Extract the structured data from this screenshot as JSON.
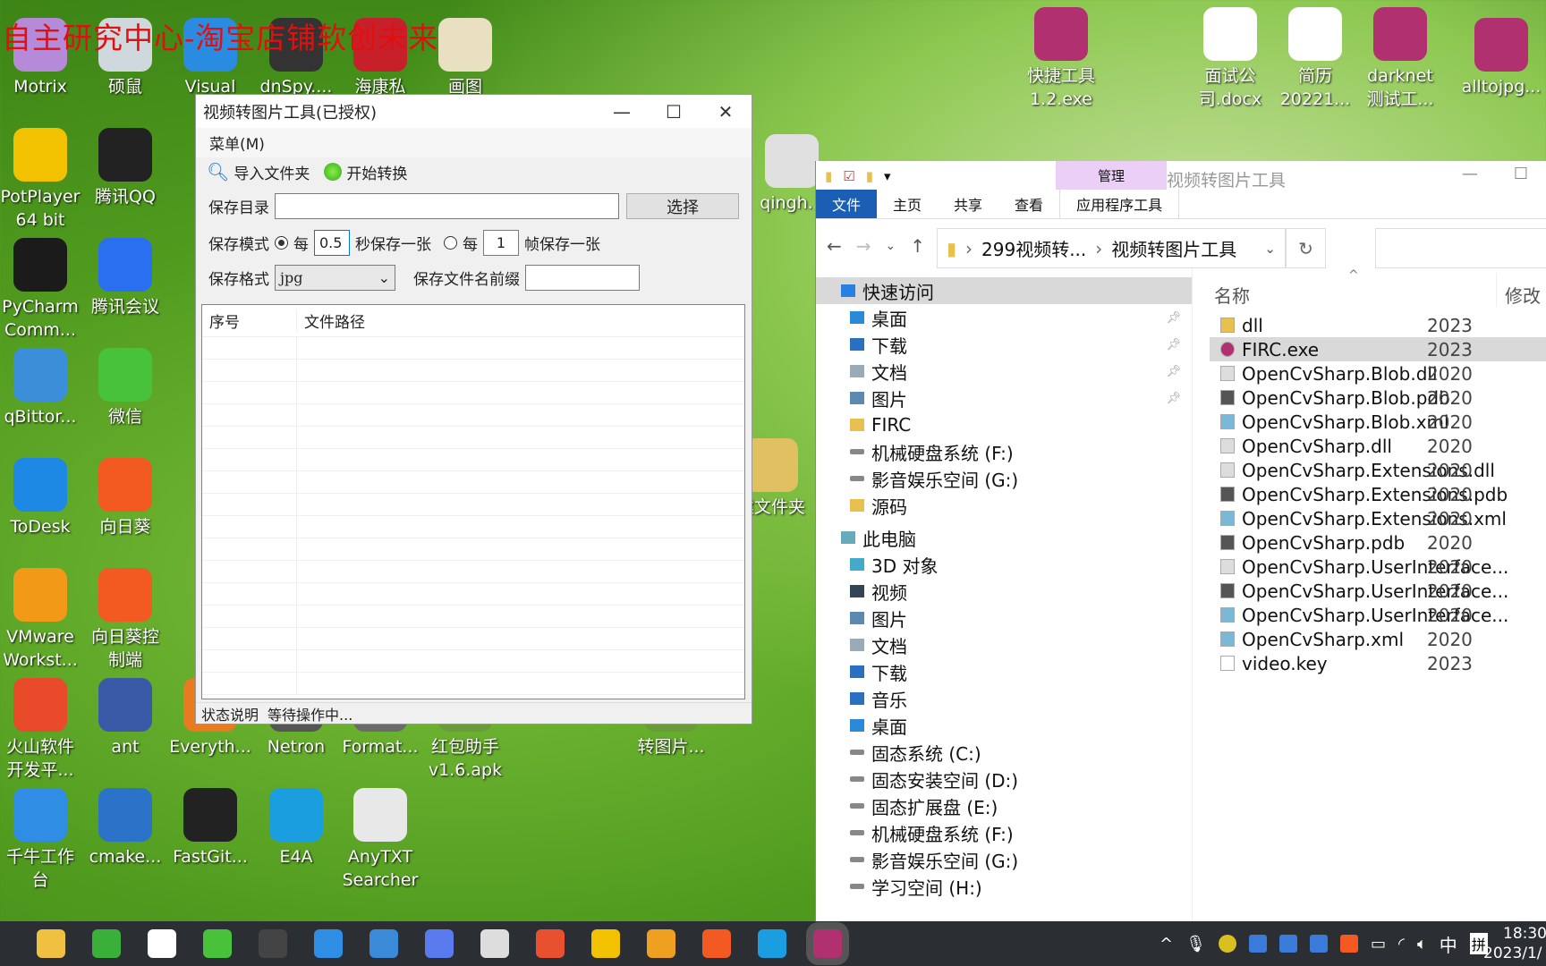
{
  "watermark": "自主研究中心-淘宝店铺软创未来",
  "desktop_icons": [
    {
      "label": "Motrix",
      "color": "#b58ad8"
    },
    {
      "label": "PotPlayer 64 bit",
      "color": "#f2c200"
    },
    {
      "label": "PyCharm Comm...",
      "color": "#1b1b1b"
    },
    {
      "label": "qBittor...",
      "color": "#3b8fd9"
    },
    {
      "label": "ToDesk",
      "color": "#1e88e5"
    },
    {
      "label": "VMware Workst...",
      "color": "#f29a18"
    },
    {
      "label": "火山软件开发平...",
      "color": "#e84a2a"
    },
    {
      "label": "千牛工作台",
      "color": "#2f8de4"
    },
    {
      "label": "硕鼠",
      "color": "#cfd8dc"
    },
    {
      "label": "腾讯QQ",
      "color": "#222222"
    },
    {
      "label": "腾讯会议",
      "color": "#2a6ff0"
    },
    {
      "label": "微信",
      "color": "#48c23a"
    },
    {
      "label": "向日葵",
      "color": "#f25a22"
    },
    {
      "label": "向日葵控制端",
      "color": "#f25a22"
    },
    {
      "label": "ant",
      "color": "#3a5aa8"
    },
    {
      "label": "cmake...",
      "color": "#2a73c8"
    },
    {
      "label": "Visual S...",
      "color": "#2a8ce0"
    },
    {
      "label": "Everyth...",
      "color": "#e87a20"
    },
    {
      "label": "FastGit...",
      "color": "#222222"
    },
    {
      "label": "dnSpy....",
      "color": "#333333"
    },
    {
      "label": "Netron",
      "color": "#555555"
    },
    {
      "label": "E4A",
      "color": "#1a9ee0"
    },
    {
      "label": "海康私有...",
      "color": "#c8202a"
    },
    {
      "label": "Format...",
      "color": "#6a6a6a"
    },
    {
      "label": "AnyTXT Searcher",
      "color": "#e8e8e8"
    },
    {
      "label": "画图",
      "color": "#e8e0c0"
    },
    {
      "label": "红包助手 v1.6.apk",
      "color": "#6a9a3a"
    },
    {
      "label": "qingh...",
      "color": "#e0e0e0"
    },
    {
      "label": "建文件夹",
      "color": "#e0c060"
    },
    {
      "label": "转图片...",
      "color": "#6a9a3a"
    },
    {
      "label": "快捷工具 1.2.exe",
      "color": "#b03070"
    },
    {
      "label": "面试公司.docx",
      "color": "#ffffff"
    },
    {
      "label": "简历 20221...",
      "color": "#ffffff"
    },
    {
      "label": "darknet 测试工...",
      "color": "#b03070"
    },
    {
      "label": "alltojpg...",
      "color": "#b03070"
    }
  ],
  "app": {
    "title": "视频转图片工具(已授权)",
    "menu": "菜单(M)",
    "toolbar": {
      "import": "导入文件夹",
      "start": "开始转换"
    },
    "save_dir_label": "保存目录",
    "save_dir_value": "",
    "choose_btn": "选择",
    "mode_label": "保存模式",
    "per": "每",
    "seconds_value": "0.5",
    "seconds_suffix": "秒保存一张",
    "per2": "每",
    "frames_value": "1",
    "frames_suffix": "帧保存一张",
    "mode_selected": "seconds",
    "format_label": "保存格式",
    "format_value": "jpg",
    "prefix_label": "保存文件名前缀",
    "prefix_value": "",
    "columns": [
      "序号",
      "文件路径"
    ],
    "status_label": "状态说明",
    "status_text": "等待操作中..."
  },
  "explorer": {
    "title": "视频转图片工具",
    "context_tab": "管理",
    "context_sub": "应用程序工具",
    "tabs": [
      "文件",
      "主页",
      "共享",
      "查看"
    ],
    "breadcrumb": [
      "299视频转...",
      "视频转图片工具"
    ],
    "nav": [
      "快速访问",
      "桌面",
      "下载",
      "文档",
      "图片",
      "FIRC",
      "机械硬盘系统 (F:)",
      "影音娱乐空间 (G:)",
      "源码",
      "此电脑",
      "3D 对象",
      "视频",
      "图片",
      "文档",
      "下载",
      "音乐",
      "桌面",
      "固态系统 (C:)",
      "固态安装空间 (D:)",
      "固态扩展盘 (E:)",
      "机械硬盘系统 (F:)",
      "影音娱乐空间 (G:)",
      "学习空间 (H:)"
    ],
    "col_name": "名称",
    "col_date": "修改",
    "files": [
      {
        "name": "dll",
        "date": "2023",
        "type": "folder"
      },
      {
        "name": "FIRC.exe",
        "date": "2023",
        "type": "exe",
        "selected": true
      },
      {
        "name": "OpenCvSharp.Blob.dll",
        "date": "2020",
        "type": "dll"
      },
      {
        "name": "OpenCvSharp.Blob.pdb",
        "date": "2020",
        "type": "pdb"
      },
      {
        "name": "OpenCvSharp.Blob.xml",
        "date": "2020",
        "type": "xml"
      },
      {
        "name": "OpenCvSharp.dll",
        "date": "2020",
        "type": "dll"
      },
      {
        "name": "OpenCvSharp.Extensions.dll",
        "date": "2020",
        "type": "dll"
      },
      {
        "name": "OpenCvSharp.Extensions.pdb",
        "date": "2020",
        "type": "pdb"
      },
      {
        "name": "OpenCvSharp.Extensions.xml",
        "date": "2020",
        "type": "xml"
      },
      {
        "name": "OpenCvSharp.pdb",
        "date": "2020",
        "type": "pdb"
      },
      {
        "name": "OpenCvSharp.UserInterface...",
        "date": "2020",
        "type": "dll"
      },
      {
        "name": "OpenCvSharp.UserInterface...",
        "date": "2020",
        "type": "pdb"
      },
      {
        "name": "OpenCvSharp.UserInterface...",
        "date": "2020",
        "type": "xml"
      },
      {
        "name": "OpenCvSharp.xml",
        "date": "2020",
        "type": "xml"
      },
      {
        "name": "video.key",
        "date": "2023",
        "type": "file"
      }
    ]
  },
  "taskbar": {
    "apps": [
      {
        "name": "file-explorer",
        "color": "#f0c040"
      },
      {
        "name": "browser-360",
        "color": "#3ab03a"
      },
      {
        "name": "upx",
        "color": "#ffffff"
      },
      {
        "name": "wechat",
        "color": "#48c23a"
      },
      {
        "name": "obs",
        "color": "#444444"
      },
      {
        "name": "qianniu",
        "color": "#2f8de4"
      },
      {
        "name": "notepad",
        "color": "#3a8ad8"
      },
      {
        "name": "feishu",
        "color": "#5a7af0"
      },
      {
        "name": "document",
        "color": "#dddddd"
      },
      {
        "name": "git",
        "color": "#e85030"
      },
      {
        "name": "potplayer",
        "color": "#f2c200"
      },
      {
        "name": "emoji-app",
        "color": "#f0a020"
      },
      {
        "name": "sunlogin",
        "color": "#f25a22"
      },
      {
        "name": "edge",
        "color": "#1a9ee0"
      },
      {
        "name": "smart-firc",
        "color": "#b03070"
      }
    ],
    "ime": "中",
    "ime2": "拼",
    "time": "18:30",
    "date": "2023/1/"
  }
}
